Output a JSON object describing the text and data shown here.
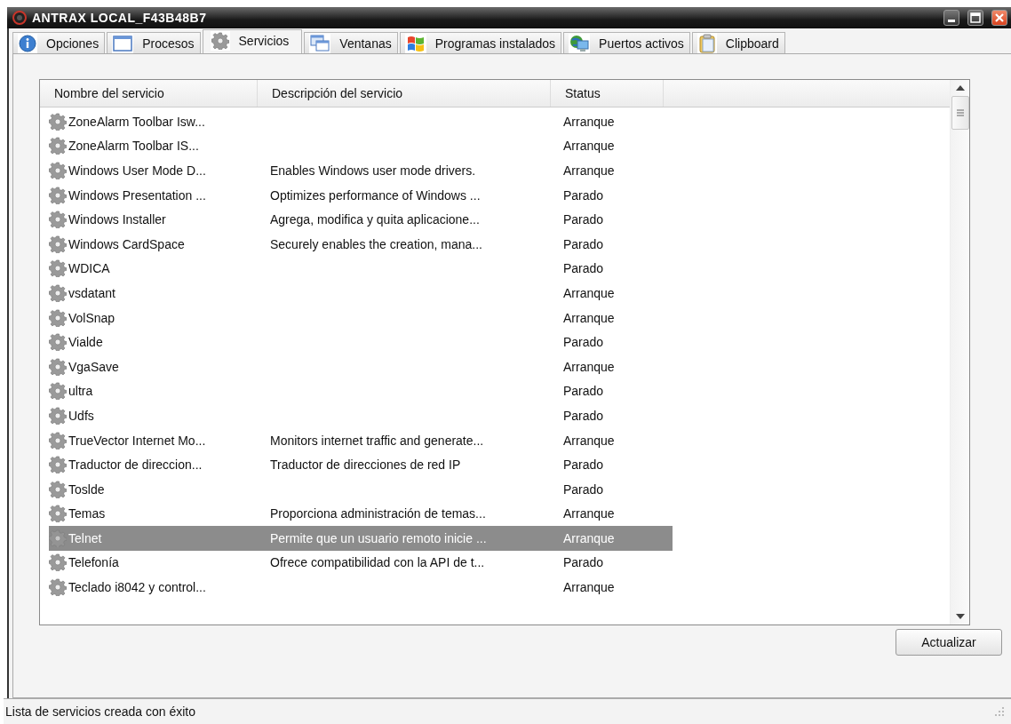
{
  "window": {
    "title": "ANTRAX LOCAL_F43B48B7"
  },
  "tabs": [
    {
      "label": "Opciones",
      "selected": false
    },
    {
      "label": "Procesos",
      "selected": false
    },
    {
      "label": "Servicios",
      "selected": true
    },
    {
      "label": "Ventanas",
      "selected": false
    },
    {
      "label": "Programas instalados",
      "selected": false
    },
    {
      "label": "Puertos activos",
      "selected": false
    },
    {
      "label": "Clipboard",
      "selected": false
    }
  ],
  "table": {
    "columns": [
      "Nombre del servicio",
      "Descripción del servicio",
      "Status"
    ],
    "rows": [
      {
        "name": "ZoneAlarm Toolbar Isw...",
        "status": "Arranque",
        "selected": false
      },
      {
        "name": "ZoneAlarm Toolbar IS...",
        "status": "Arranque",
        "selected": false
      },
      {
        "name": "Windows User Mode D...",
        "description": "Enables Windows user mode drivers.",
        "status": "Arranque",
        "selected": false
      },
      {
        "name": "Windows Presentation ...",
        "description": "Optimizes performance of Windows ...",
        "status": "Parado",
        "selected": false
      },
      {
        "name": "Windows Installer",
        "description": "Agrega, modifica y quita aplicacione...",
        "status": "Parado",
        "selected": false
      },
      {
        "name": "Windows CardSpace",
        "description": "Securely enables the creation, mana...",
        "status": "Parado",
        "selected": false
      },
      {
        "name": "WDICA",
        "status": "Parado",
        "selected": false
      },
      {
        "name": "vsdatant",
        "status": "Arranque",
        "selected": false
      },
      {
        "name": "VolSnap",
        "status": "Arranque",
        "selected": false
      },
      {
        "name": "Vialde",
        "status": "Parado",
        "selected": false
      },
      {
        "name": "VgaSave",
        "status": "Arranque",
        "selected": false
      },
      {
        "name": "ultra",
        "status": "Parado",
        "selected": false
      },
      {
        "name": "Udfs",
        "status": "Parado",
        "selected": false
      },
      {
        "name": "TrueVector Internet Mo...",
        "description": "Monitors internet traffic and generate...",
        "status": "Arranque",
        "selected": false
      },
      {
        "name": "Traductor de direccion...",
        "description": "Traductor de direcciones de red IP",
        "status": "Parado",
        "selected": false
      },
      {
        "name": "Toslde",
        "status": "Parado",
        "selected": false
      },
      {
        "name": "Temas",
        "description": "Proporciona administración de temas...",
        "status": "Arranque",
        "selected": false
      },
      {
        "name": "Telnet",
        "description": "Permite que un usuario remoto inicie ...",
        "status": "Arranque",
        "selected": true
      },
      {
        "name": "Telefonía",
        "description": "Ofrece compatibilidad con la API de t...",
        "status": "Parado",
        "selected": false
      },
      {
        "name": "Teclado i8042 y control...",
        "status": "Arranque",
        "selected": false
      }
    ]
  },
  "buttons": [
    "Actualizar"
  ],
  "status_bar": "Lista de servicios creada con éxito"
}
